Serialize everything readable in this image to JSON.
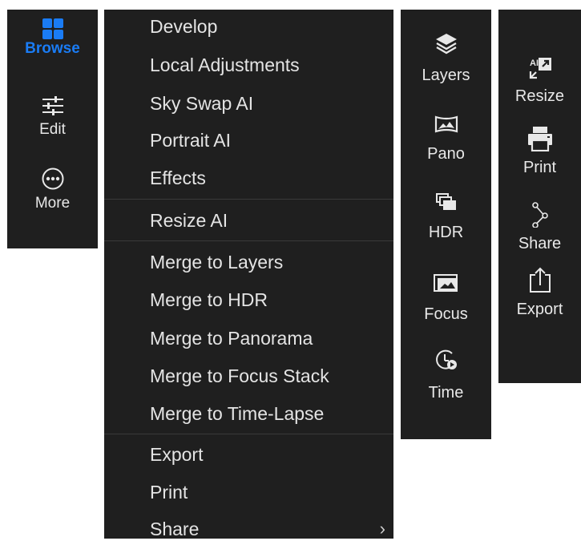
{
  "nav": {
    "items": [
      {
        "label": "Browse",
        "icon": "grid-icon",
        "active": true
      },
      {
        "label": "Edit",
        "icon": "sliders-icon",
        "active": false
      },
      {
        "label": "More",
        "icon": "more-icon",
        "active": false
      }
    ],
    "accent": "#1a7cf5"
  },
  "menu": {
    "items": [
      {
        "label": "Develop"
      },
      {
        "label": "Local Adjustments"
      },
      {
        "label": "Sky Swap AI"
      },
      {
        "label": "Portrait AI"
      },
      {
        "label": "Effects"
      },
      {
        "label": "Resize AI"
      },
      {
        "label": "Merge to Layers"
      },
      {
        "label": "Merge to HDR"
      },
      {
        "label": "Merge to Panorama"
      },
      {
        "label": "Merge to Focus Stack"
      },
      {
        "label": "Merge to Time-Lapse"
      },
      {
        "label": "Export"
      },
      {
        "label": "Print"
      },
      {
        "label": "Share",
        "submenu_indicator": "›"
      }
    ]
  },
  "merge_toolbar": {
    "items": [
      {
        "label": "Layers",
        "icon": "layers-icon"
      },
      {
        "label": "Pano",
        "icon": "panorama-icon"
      },
      {
        "label": "HDR",
        "icon": "hdr-icon"
      },
      {
        "label": "Focus",
        "icon": "focus-icon"
      },
      {
        "label": "Time",
        "icon": "time-lapse-icon"
      }
    ]
  },
  "extras_toolbar": {
    "items": [
      {
        "label": "Resize",
        "icon": "resize-ai-icon",
        "icon_text": "AI"
      },
      {
        "label": "Print",
        "icon": "printer-icon"
      },
      {
        "label": "Share",
        "icon": "share-icon"
      },
      {
        "label": "Export",
        "icon": "export-icon"
      }
    ]
  },
  "colors": {
    "panel_bg": "#1f1f1f",
    "text": "#e8e8e8",
    "separator": "#3a3a3a"
  }
}
